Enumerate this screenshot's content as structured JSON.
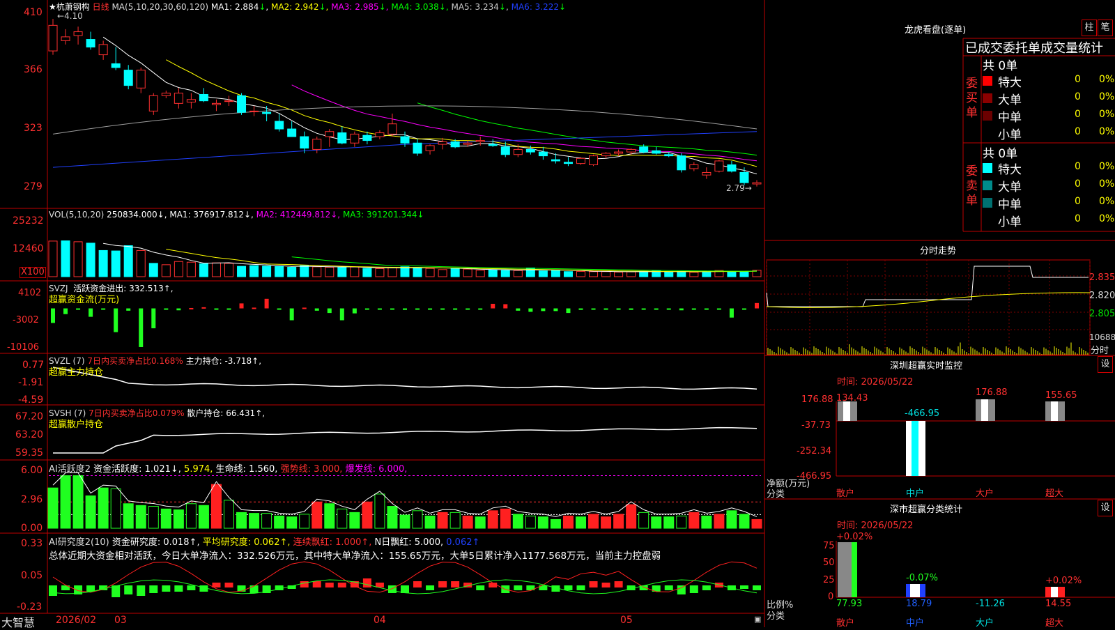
{
  "app": {
    "name": "大智慧"
  },
  "main": {
    "stock": "杭萧钢构",
    "star": "★",
    "period": "日线",
    "ma_header": "MA(5,10,20,30,60,120)",
    "ma_values": [
      {
        "name": "MA1",
        "value": "2.884",
        "dir": "↓",
        "color": "#ffffff"
      },
      {
        "name": "MA2",
        "value": "2.942",
        "dir": "↓",
        "color": "#ffff00"
      },
      {
        "name": "MA3",
        "value": "2.985",
        "dir": "↓",
        "color": "#ff00ff"
      },
      {
        "name": "MA4",
        "value": "3.038",
        "dir": "↓",
        "color": "#00ff00"
      },
      {
        "name": "MA5",
        "value": "3.234",
        "dir": "↓",
        "color": "#c0c0c0"
      },
      {
        "name": "MA6",
        "value": "3.222",
        "dir": "↓",
        "color": "#0000ff"
      }
    ],
    "y_ticks": [
      "410",
      "366",
      "323",
      "279"
    ],
    "high_label": "4.10",
    "low_label": "2.79→"
  },
  "volume": {
    "header": "VOL(5,10,20)",
    "value": "250834.000↓,",
    "ma": [
      {
        "name": "MA1",
        "value": "376917.812↓,",
        "color": "#ffffff"
      },
      {
        "name": "MA2",
        "value": "412449.812↓,",
        "color": "#ff00ff"
      },
      {
        "name": "MA3",
        "value": "391201.344↓",
        "color": "#00ff00"
      }
    ],
    "y_ticks": [
      "25232",
      "12460"
    ],
    "unit": "X100"
  },
  "svzj": {
    "title": "SVZJ",
    "label": "活跃资金进出: 332.513↑,",
    "sub": "超赢资金流(万元)",
    "y_ticks": [
      "4102",
      "-3002",
      "-10106"
    ]
  },
  "svzl": {
    "title": "SVZL (7)",
    "label1": "7日内买卖净占比0.168%",
    "label2": "主力持仓: -3.718↑,",
    "sub": "超赢主力持仓",
    "y_ticks": [
      "0.77",
      "-1.91",
      "-4.59"
    ]
  },
  "svsh": {
    "title": "SVSH (7)",
    "label1": "7日内买卖净占比0.079%",
    "label2": "散户持仓: 66.431↑,",
    "sub": "超赢散户持仓",
    "y_ticks": [
      "67.20",
      "63.20",
      "59.35"
    ]
  },
  "ai_active": {
    "title": "AI活跃度2",
    "label1": "资金活跃度: 1.021↓,",
    "label2": "5.974,",
    "label3": "生命线: 1.560,",
    "label4": "强势线: 3.000,",
    "label5": "爆发线: 6.000,",
    "y_ticks": [
      "6.00",
      "2.96",
      "0.00"
    ]
  },
  "ai_research": {
    "title": "AI研究度2(10)",
    "label1": "资金研究度: 0.018↑,",
    "label2": "平均研究度: 0.062↑,",
    "label3": "连续飘红: 1.000↑,",
    "label4": "N日飘红: 5.000,",
    "label5": "0.062↑",
    "summary": "总体近期大资金相对活跃，今日大单净流入：332.526万元，其中特大单净流入：155.65万元，大单5日累计净入1177.568万元，当前主力控盘弱",
    "y_ticks": [
      "0.33",
      "0.05",
      "-0.23"
    ]
  },
  "x_axis": {
    "labels": [
      "2026/02",
      "03",
      "04",
      "05"
    ]
  },
  "right": {
    "dragon_title": "龙虎看盘(逐单)",
    "tabs": [
      "柱",
      "笔"
    ],
    "stats_title": "已成交委托单成交量统计",
    "buy_side": "委买单",
    "sell_side": "委卖单",
    "buy_total": "共 0单",
    "sell_total": "共 0单",
    "rows": [
      "特大",
      "大单",
      "中单",
      "小单"
    ],
    "zero": "0",
    "zero_pct": "0%",
    "buy_colors": [
      "#ff0000",
      "#8b0000",
      "#6b0000",
      "#000000"
    ],
    "sell_colors": [
      "#00ffff",
      "#008b8b",
      "#007070",
      "#000000"
    ],
    "intraday_title": "分时走势",
    "intraday_ticks": [
      "2.835",
      "2.820",
      "2.805"
    ],
    "intraday_vol": "10688",
    "intraday_vol_unit": "分时",
    "monitor_title": "深圳超赢实时监控",
    "monitor_tab": "设",
    "monitor_time": "时间: 2026/05/22",
    "monitor_ticks": [
      "176.88",
      "-37.73",
      "-252.34",
      "-466.95"
    ],
    "monitor_ylabel1": "净额(万元)",
    "monitor_ylabel2": "分类",
    "stat_title": "深市超赢分类统计",
    "stat_tab": "设",
    "stat_time": "时间: 2026/05/22",
    "stat_ticks": [
      "75",
      "50",
      "25",
      "0"
    ],
    "stat_ylabel1": "比例%",
    "stat_ylabel2": "分类"
  },
  "chart_data": [
    {
      "type": "candlestick",
      "title": "杭萧钢构 日线",
      "ylim": [
        2.75,
        4.15
      ],
      "y_ticks": [
        4.1,
        3.66,
        3.23,
        2.79
      ],
      "high": 4.1,
      "low": 2.79,
      "x_labels": [
        "2026/02",
        "03",
        "04",
        "05"
      ],
      "candles_ohlc": [
        [
          3.85,
          4.1,
          3.82,
          4.05
        ],
        [
          3.93,
          4.02,
          3.9,
          3.96
        ],
        [
          3.97,
          4.04,
          3.9,
          4.0
        ],
        [
          3.94,
          4.0,
          3.86,
          3.88
        ],
        [
          3.82,
          3.93,
          3.78,
          3.9
        ],
        [
          3.75,
          3.88,
          3.7,
          3.72
        ],
        [
          3.7,
          3.74,
          3.55,
          3.58
        ],
        [
          3.56,
          3.72,
          3.52,
          3.7
        ],
        [
          3.38,
          3.52,
          3.35,
          3.5
        ],
        [
          3.5,
          3.54,
          3.48,
          3.52
        ],
        [
          3.44,
          3.56,
          3.4,
          3.52
        ],
        [
          3.45,
          3.52,
          3.4,
          3.47
        ],
        [
          3.51,
          3.56,
          3.45,
          3.46
        ],
        [
          3.43,
          3.47,
          3.38,
          3.44
        ],
        [
          3.46,
          3.5,
          3.42,
          3.46
        ],
        [
          3.5,
          3.52,
          3.35,
          3.37
        ],
        [
          3.38,
          3.42,
          3.34,
          3.38
        ],
        [
          3.37,
          3.42,
          3.3,
          3.36
        ],
        [
          3.3,
          3.36,
          3.22,
          3.24
        ],
        [
          3.24,
          3.3,
          3.18,
          3.18
        ],
        [
          3.18,
          3.22,
          3.05,
          3.09
        ],
        [
          3.08,
          3.18,
          3.05,
          3.16
        ],
        [
          3.18,
          3.24,
          3.1,
          3.22
        ],
        [
          3.21,
          3.26,
          3.12,
          3.13
        ],
        [
          3.13,
          3.22,
          3.1,
          3.2
        ],
        [
          3.19,
          3.22,
          3.12,
          3.15
        ],
        [
          3.18,
          3.23,
          3.16,
          3.21
        ],
        [
          3.2,
          3.36,
          3.18,
          3.28
        ],
        [
          3.18,
          3.22,
          3.1,
          3.13
        ],
        [
          3.13,
          3.16,
          3.03,
          3.05
        ],
        [
          3.07,
          3.12,
          3.04,
          3.11
        ],
        [
          3.12,
          3.17,
          3.08,
          3.14
        ],
        [
          3.14,
          3.16,
          3.09,
          3.1
        ],
        [
          3.12,
          3.15,
          3.1,
          3.13
        ],
        [
          3.14,
          3.18,
          3.11,
          3.15
        ],
        [
          3.12,
          3.16,
          3.1,
          3.11
        ],
        [
          3.1,
          3.14,
          3.02,
          3.04
        ],
        [
          3.04,
          3.12,
          3.02,
          3.08
        ],
        [
          3.08,
          3.11,
          3.04,
          3.06
        ],
        [
          3.06,
          3.1,
          3.0,
          3.03
        ],
        [
          3.0,
          3.05,
          2.97,
          2.99
        ],
        [
          2.98,
          3.02,
          2.95,
          2.97
        ],
        [
          2.97,
          3.02,
          2.96,
          3.01
        ],
        [
          2.96,
          3.04,
          2.95,
          3.03
        ],
        [
          3.03,
          3.06,
          3.01,
          3.05
        ],
        [
          3.05,
          3.08,
          3.03,
          3.06
        ],
        [
          3.06,
          3.09,
          3.04,
          3.08
        ],
        [
          3.1,
          3.12,
          3.05,
          3.06
        ],
        [
          3.07,
          3.1,
          3.04,
          3.05
        ],
        [
          3.04,
          3.06,
          3.02,
          3.03
        ],
        [
          3.03,
          3.05,
          2.9,
          2.92
        ],
        [
          2.93,
          2.98,
          2.91,
          2.96
        ],
        [
          2.88,
          2.94,
          2.85,
          2.9
        ],
        [
          2.91,
          3.0,
          2.9,
          2.99
        ],
        [
          2.96,
          2.99,
          2.9,
          2.91
        ],
        [
          2.9,
          2.94,
          2.8,
          2.82
        ],
        [
          2.81,
          2.84,
          2.79,
          2.82
        ]
      ]
    },
    {
      "type": "bar",
      "title": "VOL(5,10,20)",
      "ylim": [
        0,
        27000
      ],
      "values": [
        15500,
        15600,
        15200,
        14600,
        11400,
        11200,
        13500,
        11400,
        5800,
        5200,
        6600,
        6300,
        5600,
        6000,
        5800,
        4500,
        4800,
        4600,
        4400,
        4100,
        4800,
        4300,
        4100,
        4000,
        4200,
        3600,
        3500,
        3900,
        4300,
        4000,
        3600,
        3100,
        3500,
        3300,
        2800,
        2900,
        2700,
        2700,
        3800,
        2500,
        2700,
        2200,
        2300,
        2200,
        2200,
        2000,
        2100,
        2300,
        2500,
        2100,
        2300,
        1900,
        2300,
        2700,
        2400,
        2300,
        2800
      ],
      "colors_up": [
        true,
        false,
        true,
        false,
        false,
        false,
        false,
        true,
        false,
        true,
        true,
        true,
        false,
        true,
        true,
        false,
        false,
        false,
        false,
        false,
        false,
        true,
        true,
        false,
        true,
        false,
        true,
        true,
        false,
        false,
        true,
        true,
        false,
        true,
        true,
        false,
        false,
        true,
        false,
        false,
        false,
        false,
        true,
        true,
        true,
        true,
        true,
        false,
        false,
        false,
        false,
        true,
        false,
        true,
        false,
        false,
        true
      ]
    },
    {
      "type": "bar",
      "title": "超赢资金流(万元)",
      "ylim": [
        -10106,
        4102
      ],
      "values": [
        -3800,
        -1500,
        -300,
        -2200,
        -200,
        -6200,
        -600,
        -10100,
        -5200,
        -300,
        -500,
        100,
        300,
        -200,
        -150,
        1300,
        200,
        2500,
        -100,
        -3100,
        200,
        -600,
        -1200,
        -3100,
        -1300,
        -300,
        -200,
        -200,
        -400,
        -300,
        -200,
        -150,
        -250,
        -200,
        -150,
        1200,
        1100,
        -600,
        -900,
        -700,
        -700,
        -1200,
        -400,
        -200,
        -200,
        -200,
        -400,
        -200,
        -250,
        -200,
        -500,
        -200,
        -100,
        -200,
        -2400,
        -200,
        1400
      ]
    }
  ]
}
